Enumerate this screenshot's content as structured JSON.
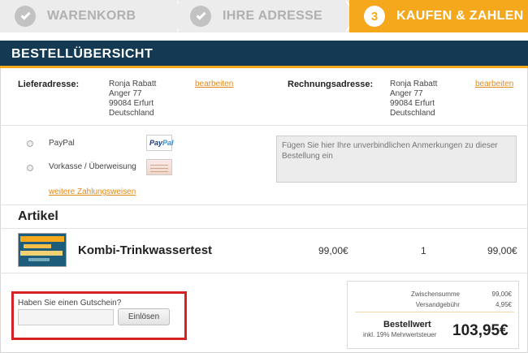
{
  "steps": [
    {
      "label": "WARENKORB",
      "state": "done"
    },
    {
      "label": "IHRE ADRESSE",
      "state": "done"
    },
    {
      "number": "3",
      "label": "KAUFEN & ZAHLEN",
      "state": "active"
    }
  ],
  "colors": {
    "accent": "#f5a81c",
    "header": "#133a52",
    "highlight": "#d42323"
  },
  "header": {
    "title": "BESTELLÜBERSICHT"
  },
  "shipping": {
    "label": "Lieferadresse:",
    "lines": [
      "Ronja Rabatt",
      "Anger 77",
      "99084 Erfurt",
      "Deutschland"
    ],
    "edit": "bearbeiten"
  },
  "billing": {
    "label": "Rechnungsadresse:",
    "lines": [
      "Ronja Rabatt",
      "Anger 77",
      "99084 Erfurt",
      "Deutschland"
    ],
    "edit": "bearbeiten"
  },
  "payment": {
    "options": [
      {
        "label": "PayPal",
        "icon": "paypal-logo-icon",
        "logo_text": [
          "Pay",
          "Pal"
        ]
      },
      {
        "label": "Vorkasse / Überweisung",
        "icon": "bank-transfer-icon"
      }
    ],
    "more": "weitere Zahlungsweisen"
  },
  "notes": {
    "placeholder": "Fügen Sie hier Ihre unverbindlichen Anmerkungen zu dieser Bestellung ein"
  },
  "articles": {
    "heading": "Artikel",
    "items": [
      {
        "name": "Kombi-Trinkwassertest",
        "price": "99,00€",
        "quantity": "1",
        "total": "99,00€",
        "image": "product-thumbnail"
      }
    ]
  },
  "voucher": {
    "question": "Haben Sie einen Gutschein?",
    "input_value": "",
    "button": "Einlösen"
  },
  "totals": {
    "subtotal_label": "Zwischensumme",
    "subtotal": "99,00€",
    "shipping_label": "Versandgebühr",
    "shipping": "4,95€",
    "grand_label": "Bestellwert",
    "tax_note": "inkl. 19% Mehrwertsteuer",
    "grand": "103,95€"
  }
}
